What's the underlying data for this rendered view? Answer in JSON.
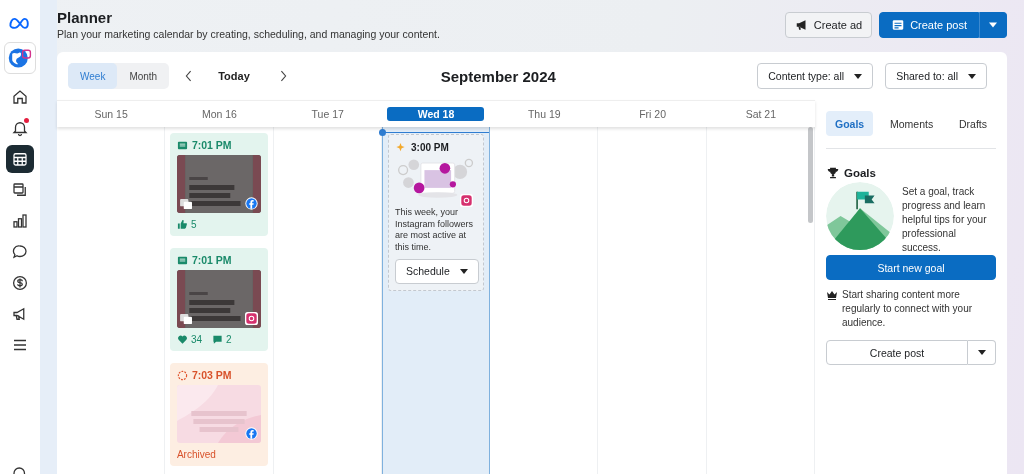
{
  "sidebar": {
    "items": [
      {
        "selected": false,
        "notification": false
      },
      {
        "selected": false,
        "notification": true
      },
      {
        "selected": true,
        "notification": false
      },
      {
        "selected": false,
        "notification": false
      },
      {
        "selected": false,
        "notification": false
      },
      {
        "selected": false,
        "notification": false
      },
      {
        "selected": false,
        "notification": false
      },
      {
        "selected": false,
        "notification": false
      },
      {
        "selected": false,
        "notification": false
      },
      {
        "selected": false,
        "notification": false
      }
    ]
  },
  "header": {
    "title": "Planner",
    "subtitle": "Plan your marketing calendar by creating, scheduling, and managing your content.",
    "create_ad": "Create ad",
    "create_post": "Create post"
  },
  "toolbar": {
    "views": [
      {
        "label": "Week",
        "selected": true
      },
      {
        "label": "Month",
        "selected": false
      }
    ],
    "today": "Today",
    "period": "September 2024",
    "filters": [
      "Content type: all",
      "Shared to: all"
    ]
  },
  "days": [
    {
      "label": "Sun 15",
      "selected": false
    },
    {
      "label": "Mon 16",
      "selected": false,
      "cards": [
        {
          "kind": "published",
          "time": "7:01 PM",
          "instagram": false,
          "stats": [
            {
              "kind": "likes",
              "value": "5"
            }
          ]
        },
        {
          "kind": "published",
          "time": "7:01 PM",
          "instagram": true,
          "stats": [
            {
              "kind": "hearts",
              "value": "34"
            },
            {
              "kind": "comments",
              "value": "2"
            }
          ]
        },
        {
          "kind": "archived",
          "time": "7:03 PM",
          "instagram": false,
          "status": "Archived"
        }
      ]
    },
    {
      "label": "Tue 17",
      "selected": false
    },
    {
      "label": "Wed 18",
      "selected": true,
      "cards": [
        {
          "kind": "suggestion",
          "time": "3:00 PM",
          "instagram": true,
          "text": "This week, your Instagram followers are most active at this time.",
          "button": "Schedule"
        }
      ]
    },
    {
      "label": "Thu 19",
      "selected": false
    },
    {
      "label": "Fri 20",
      "selected": false
    },
    {
      "label": "Sat 21",
      "selected": false
    }
  ],
  "panel": {
    "tabs": [
      {
        "label": "Goals",
        "selected": true
      },
      {
        "label": "Moments",
        "selected": false
      },
      {
        "label": "Drafts",
        "selected": false
      }
    ],
    "heading": "Goals",
    "description": "Set a goal, track progress and learn helpful tips for your professional success.",
    "start_button": "Start new goal",
    "tip": "Start sharing content more regularly to connect with your audience.",
    "create_post": "Create post"
  }
}
